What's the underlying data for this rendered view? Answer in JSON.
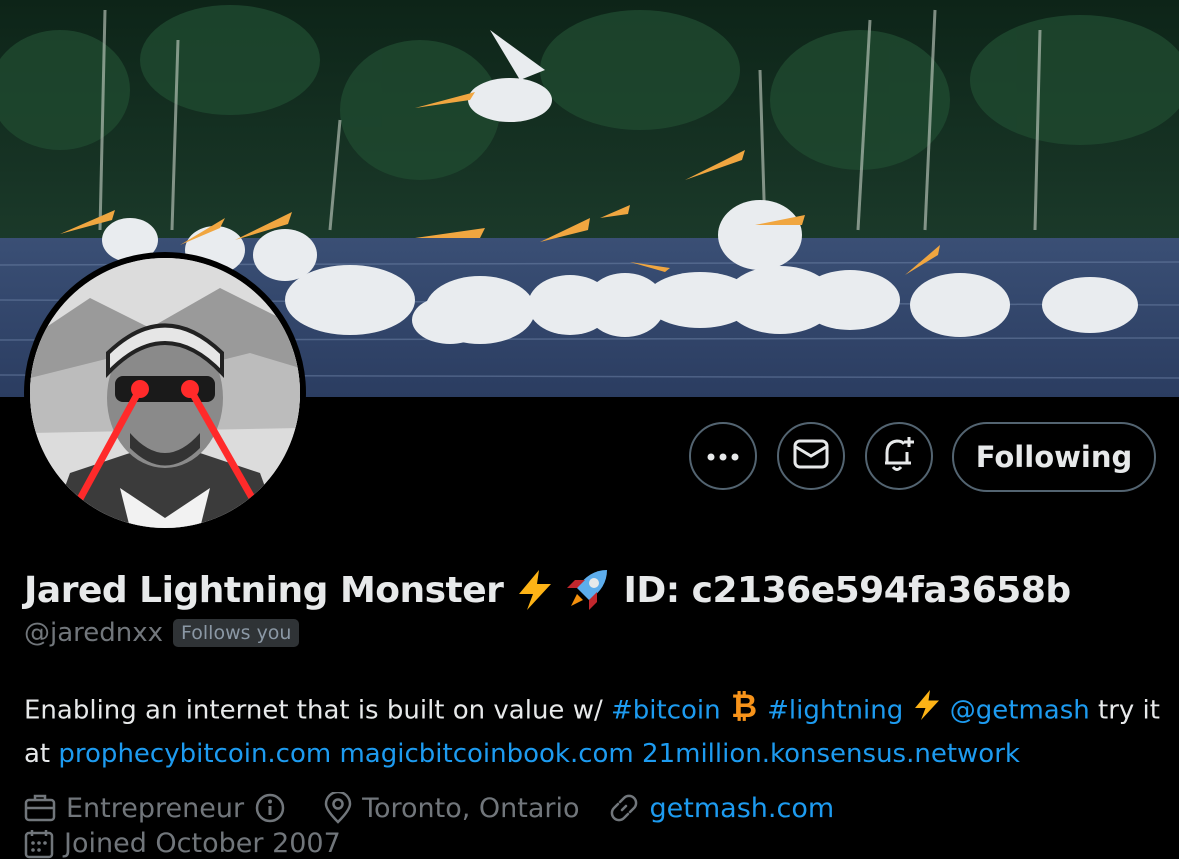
{
  "profile": {
    "name": "Jared Lightning Monster",
    "id_text": "ID: c2136e594fa3658b",
    "handle": "@jarednxx",
    "follows_badge": "Follows you"
  },
  "actions": {
    "more_label": "More",
    "message_label": "Message",
    "notify_label": "Turn on notifications",
    "following_label": "Following"
  },
  "bio": {
    "text1": "Enabling an internet that is built on value w/ ",
    "hashtag_bitcoin": "#bitcoin",
    "hashtag_lightning": "#lightning",
    "mention": "@getmash",
    "text2": " try it at ",
    "link1": "prophecybitcoin.com",
    "link2": "magicbitcoinbook.com",
    "link3": "21million.konsensus.network"
  },
  "meta": {
    "profession": "Entrepreneur",
    "location": "Toronto, Ontario",
    "website": "getmash.com",
    "joined": "Joined October 2007"
  },
  "icons": {
    "more": "ellipsis-icon",
    "message": "envelope-icon",
    "notify": "bell-plus-icon",
    "profession": "briefcase-icon",
    "info": "info-icon",
    "location": "map-pin-icon",
    "website": "link-icon",
    "calendar": "calendar-icon"
  },
  "colors": {
    "link": "#1d9bf0",
    "secondary_text": "#71767b",
    "border": "#536471"
  }
}
